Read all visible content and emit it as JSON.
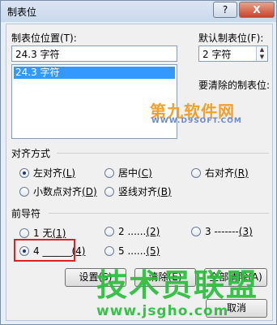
{
  "dialog": {
    "title": "制表位",
    "help_label": "?",
    "close_label": "X"
  },
  "tab_stop_position": {
    "label": "制表位位置(T):",
    "value": "24.3 字符",
    "list": [
      "24.3 字符"
    ]
  },
  "default_tab_stops": {
    "label": "默认制表位(F):",
    "value": "2 字符"
  },
  "to_be_cleared_label": "要清除的制表位:",
  "alignment": {
    "heading": "对齐方式",
    "options": [
      {
        "label": "左对齐",
        "key": "(L)",
        "selected": true
      },
      {
        "label": "居中",
        "key": "(C)",
        "selected": false
      },
      {
        "label": "右对齐",
        "key": "(R)",
        "selected": false
      },
      {
        "label": "小数点对齐",
        "key": "(D)",
        "selected": false
      },
      {
        "label": "竖线对齐",
        "key": "(B)",
        "selected": false
      }
    ]
  },
  "leader": {
    "heading": "前导符",
    "options": [
      {
        "label": "1 无",
        "key": "(1)",
        "selected": false
      },
      {
        "label": "2 ......",
        "key": "(2)",
        "selected": false
      },
      {
        "label": "3 -------",
        "key": "(3)",
        "selected": false
      },
      {
        "label": "4 ______",
        "key": "(4)",
        "selected": true
      },
      {
        "label": "5 ......",
        "key": "(5)",
        "selected": false
      }
    ]
  },
  "buttons": {
    "set": "设置(S)",
    "clear": "清除(E)",
    "clear_all": "全部清除(A)",
    "cancel": "取消"
  },
  "watermarks": {
    "top_text": "第九软件网",
    "top_url": "WWW.D9SOFT.COM",
    "bottom_text": "技术员联盟",
    "bottom_url": "www.jsgho.com"
  },
  "colors": {
    "selection": "#3399ff",
    "highlight_box": "#e02020",
    "watermark_green": "#28be3c",
    "watermark_orange": "#f0a030"
  }
}
